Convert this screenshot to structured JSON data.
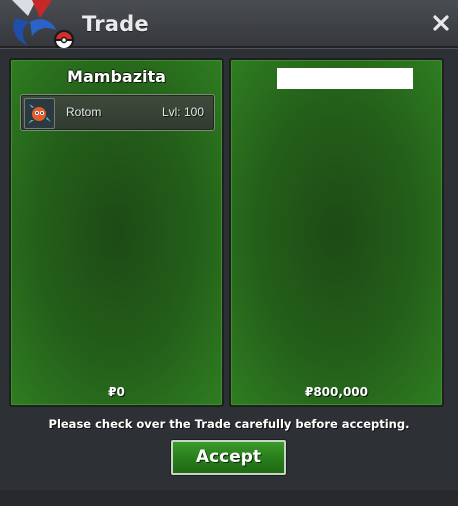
{
  "window": {
    "title": "Trade",
    "logo_icon": "pokeball-logo-icon",
    "close_icon": "close-icon"
  },
  "left_panel": {
    "trainer_name": "Mambazita",
    "pokemon": [
      {
        "name": "Rotom",
        "level": "Lvl: 100",
        "icon": "rotom-sprite-icon"
      }
    ],
    "money": "₽0"
  },
  "right_panel": {
    "trainer_name": "",
    "money": "₽800,000"
  },
  "notice": "Please check over the Trade carefully before accepting.",
  "accept_label": "Accept",
  "colors": {
    "panel_green": "#24601a",
    "button_green": "#267a1a",
    "window_bg": "#2d3034"
  }
}
